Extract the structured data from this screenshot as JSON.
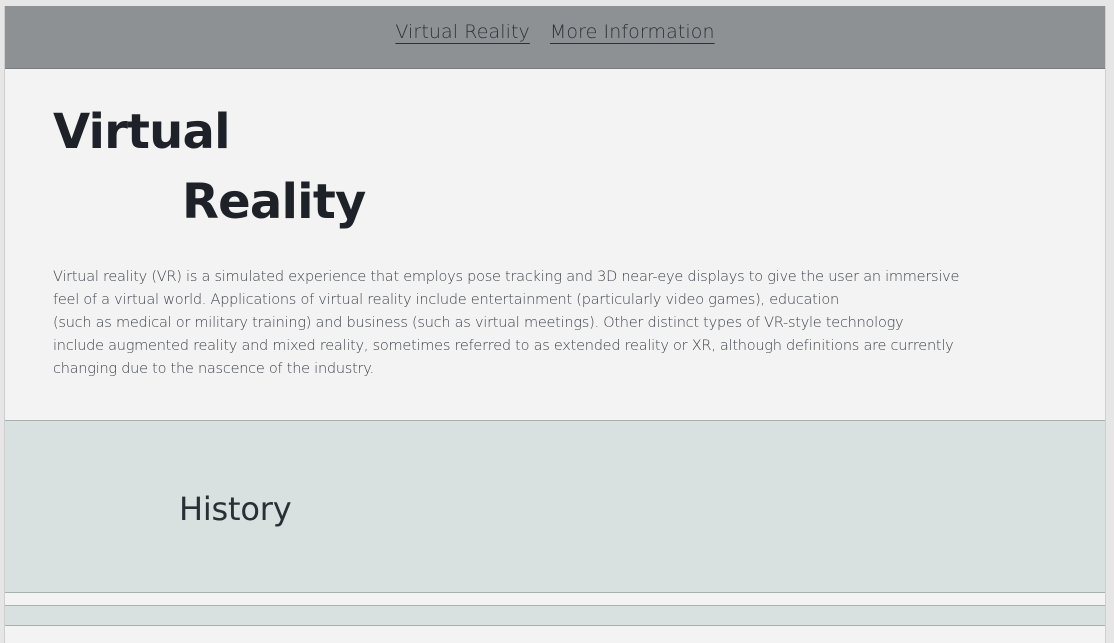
{
  "nav": {
    "links": [
      {
        "label": "Virtual Reality"
      },
      {
        "label": "More Information"
      }
    ]
  },
  "hero": {
    "title_line1": "Virtual",
    "title_line2": "Reality",
    "intro_lines": [
      "Virtual reality (VR) is a simulated experience that employs pose tracking and 3D near-eye displays to give the user an immersive",
      "feel of a virtual world. Applications of virtual reality include entertainment (particularly video games), education",
      "(such as medical or military training) and business (such as virtual meetings). Other distinct types of VR-style technology",
      "include augmented reality and mixed reality, sometimes referred to as extended reality or XR, although definitions are currently",
      "changing due to the nascence of the industry."
    ]
  },
  "history": {
    "heading": "History"
  },
  "colors": {
    "nav_background": "#8e9194",
    "page_background": "#f3f3f3",
    "section_background": "#d9e0e0",
    "title_text": "#1f2129"
  }
}
